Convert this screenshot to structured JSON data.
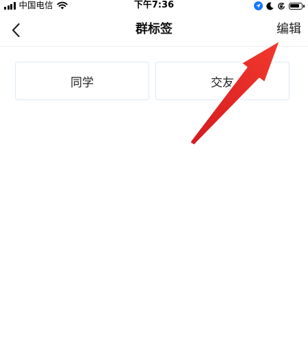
{
  "status_bar": {
    "carrier": "中国电信",
    "time": "下午7:36",
    "signal_icon": "signal-bars-icon",
    "wifi_icon": "wifi-icon",
    "right_icons": [
      "location-arrow-icon",
      "moon-icon",
      "rotation-lock-icon",
      "battery-icon"
    ],
    "battery_level": 0.85
  },
  "nav": {
    "back_icon": "chevron-left-icon",
    "title": "群标签",
    "edit_label": "编辑"
  },
  "tags": [
    {
      "label": "同学"
    },
    {
      "label": "交友"
    }
  ],
  "colors": {
    "background": "#ffffff",
    "tag_border": "#dce8f5",
    "divider": "#eeeeee",
    "annotation_arrow": "#e8262a"
  }
}
